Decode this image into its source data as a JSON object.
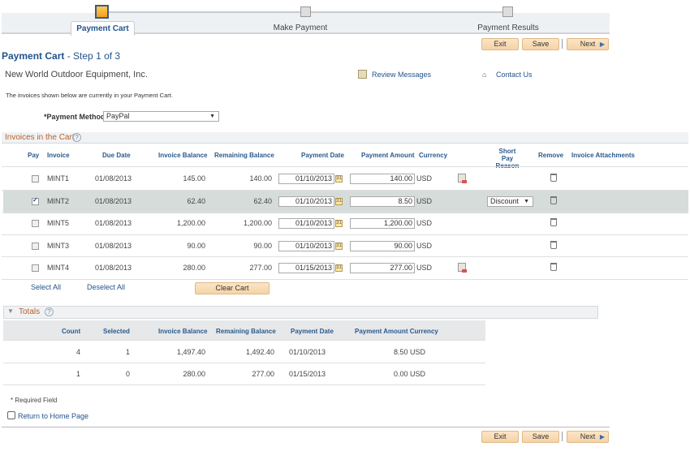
{
  "train": {
    "steps": [
      {
        "label": "Payment Cart",
        "active": true
      },
      {
        "label": "Make Payment",
        "active": false
      },
      {
        "label": "Payment Results",
        "active": false
      }
    ]
  },
  "toolbar": {
    "exit_label": "Exit",
    "save_label": "Save",
    "next_label": "Next",
    "next_arrow": "▶"
  },
  "header": {
    "title": "Payment Cart",
    "subtitle": "- Step 1 of 3",
    "company": "New World Outdoor Equipment, Inc.",
    "review_messages": "Review Messages",
    "contact_us": "Contact Us",
    "info_text": "The invoices shown below are currently in your Payment Cart."
  },
  "payment_method": {
    "label": "*Payment Method",
    "value": "PayPal"
  },
  "invoices": {
    "section_title": "Invoices in the Cart",
    "help": "?",
    "columns": [
      "Pay",
      "Invoice",
      "Due Date",
      "Invoice Balance",
      "Remaining Balance",
      "Payment Date",
      "Payment Amount",
      "Currency",
      "Short Pay Reason",
      "Remove",
      "Invoice Attachments"
    ],
    "short_pay_line1": "Short Pay",
    "short_pay_line2": "Reason",
    "rows": [
      {
        "pay": false,
        "invoice": "MINT1",
        "due": "01/08/2013",
        "inv_bal": "145.00",
        "rem_bal": "140.00",
        "pay_date": "01/10/2013",
        "amount": "140.00",
        "currency": "USD",
        "reason": "",
        "attachment": true
      },
      {
        "pay": true,
        "invoice": "MINT2",
        "due": "01/08/2013",
        "inv_bal": "62.40",
        "rem_bal": "62.40",
        "pay_date": "01/10/2013",
        "amount": "8.50",
        "currency": "USD",
        "reason": "Discount",
        "attachment": false
      },
      {
        "pay": false,
        "invoice": "MINT5",
        "due": "01/08/2013",
        "inv_bal": "1,200.00",
        "rem_bal": "1,200.00",
        "pay_date": "01/10/2013",
        "amount": "1,200.00",
        "currency": "USD",
        "reason": "",
        "attachment": false
      },
      {
        "pay": false,
        "invoice": "MINT3",
        "due": "01/08/2013",
        "inv_bal": "90.00",
        "rem_bal": "90.00",
        "pay_date": "01/10/2013",
        "amount": "90.00",
        "currency": "USD",
        "reason": "",
        "attachment": false
      },
      {
        "pay": false,
        "invoice": "MINT4",
        "due": "01/08/2013",
        "inv_bal": "280.00",
        "rem_bal": "277.00",
        "pay_date": "01/15/2013",
        "amount": "277.00",
        "currency": "USD",
        "reason": "",
        "attachment": true
      }
    ],
    "select_all": "Select All",
    "deselect_all": "Deselect All",
    "clear_cart": "Clear Cart"
  },
  "totals": {
    "section_title": "Totals",
    "help": "?",
    "columns": [
      "Count",
      "Selected",
      "Invoice Balance",
      "Remaining Balance",
      "Payment Date",
      "Payment Amount Currency"
    ],
    "rows": [
      {
        "count": "4",
        "selected": "1",
        "inv_bal": "1,497.40",
        "rem_bal": "1,492.40",
        "pay_date": "01/10/2013",
        "amount": "8.50 USD"
      },
      {
        "count": "1",
        "selected": "0",
        "inv_bal": "280.00",
        "rem_bal": "277.00",
        "pay_date": "01/15/2013",
        "amount": "0.00 USD"
      }
    ]
  },
  "footer": {
    "required": "* Required Field",
    "return_home": "Return to Home Page"
  },
  "colors": {
    "accent": "#22548c",
    "section": "#b8632a",
    "button": "#f6d3a5"
  }
}
